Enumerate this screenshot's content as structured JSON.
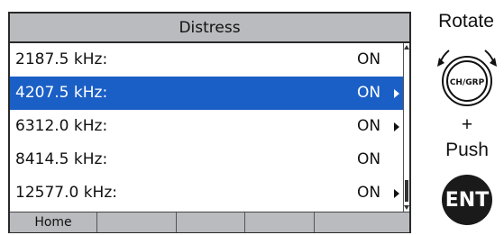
{
  "screen": {
    "title": "Distress",
    "rows": [
      {
        "freq": "2187.5 kHz:",
        "status": "ON",
        "has_arrow": false,
        "selected": false
      },
      {
        "freq": "4207.5 kHz:",
        "status": "ON",
        "has_arrow": true,
        "selected": true
      },
      {
        "freq": "6312.0 kHz:",
        "status": "ON",
        "has_arrow": true,
        "selected": false
      },
      {
        "freq": "8414.5 kHz:",
        "status": "ON",
        "has_arrow": false,
        "selected": false
      },
      {
        "freq": "12577.0 kHz:",
        "status": "ON",
        "has_arrow": true,
        "selected": false
      }
    ],
    "softkeys": [
      "Home",
      "",
      "",
      "",
      ""
    ]
  },
  "controls": {
    "rotate_label": "Rotate",
    "knob_label": "CH/GRP",
    "plus_label": "+",
    "push_label": "Push",
    "ent_label": "ENT"
  },
  "colors": {
    "selection": "#1a5fc6",
    "title_bar": "#b9bbbe",
    "softkey": "#b9bbbe"
  }
}
